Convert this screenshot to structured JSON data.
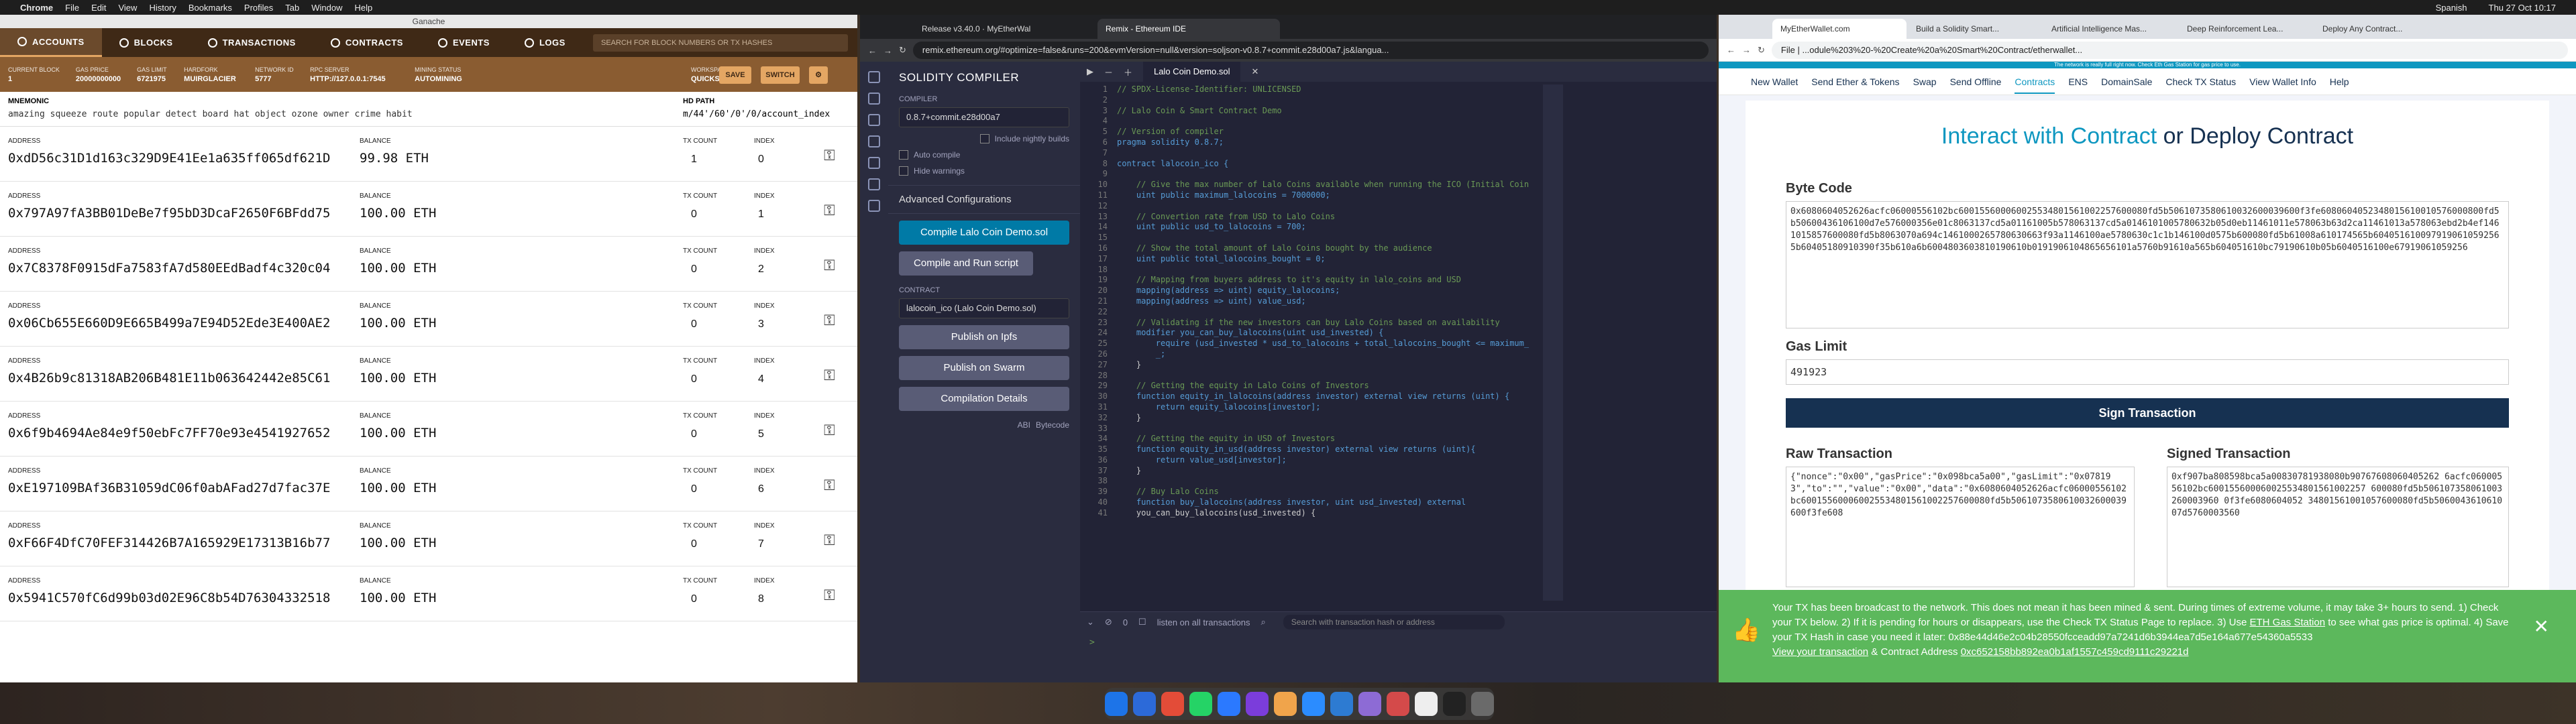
{
  "menubar": {
    "app": "Chrome",
    "items": [
      "File",
      "Edit",
      "View",
      "History",
      "Bookmarks",
      "Profiles",
      "Tab",
      "Window",
      "Help"
    ],
    "sys_input": "Spanish",
    "clock": "Thu 27 Oct 10:17"
  },
  "ganache": {
    "window_title": "Ganache",
    "nav": [
      "ACCOUNTS",
      "BLOCKS",
      "TRANSACTIONS",
      "CONTRACTS",
      "EVENTS",
      "LOGS"
    ],
    "search_placeholder": "SEARCH FOR BLOCK NUMBERS OR TX HASHES",
    "stats": [
      {
        "label": "CURRENT BLOCK",
        "value": "1"
      },
      {
        "label": "GAS PRICE",
        "value": "20000000000"
      },
      {
        "label": "GAS LIMIT",
        "value": "6721975"
      },
      {
        "label": "HARDFORK",
        "value": "MUIRGLACIER"
      },
      {
        "label": "NETWORK ID",
        "value": "5777"
      },
      {
        "label": "RPC SERVER",
        "value": "HTTP://127.0.0.1:7545"
      },
      {
        "label": "MINING STATUS",
        "value": "AUTOMINING"
      },
      {
        "label": "WORKSPACE",
        "value": "QUICKSTART"
      }
    ],
    "save": "SAVE",
    "switch": "SWITCH",
    "mnemonic_label": "MNEMONIC",
    "mnemonic": "amazing squeeze route popular detect board hat object ozone owner crime habit",
    "hdpath_label": "HD PATH",
    "hdpath": "m/44'/60'/0'/0/account_index",
    "col_address": "ADDRESS",
    "col_balance": "BALANCE",
    "col_tx": "TX COUNT",
    "col_index": "INDEX",
    "accounts": [
      {
        "address": "0xdD56c31D1d163c329D9E41Ee1a635ff065df621D",
        "balance": "99.98 ETH",
        "tx": "1",
        "index": "0"
      },
      {
        "address": "0x797A97fA3BB01DeBe7f95bD3DcaF2650F6BFdd75",
        "balance": "100.00 ETH",
        "tx": "0",
        "index": "1"
      },
      {
        "address": "0x7C8378F0915dFa7583fA7d580EEdBadf4c320c04",
        "balance": "100.00 ETH",
        "tx": "0",
        "index": "2"
      },
      {
        "address": "0x06Cb655E660D9E665B499a7E94D52Ede3E400AE2",
        "balance": "100.00 ETH",
        "tx": "0",
        "index": "3"
      },
      {
        "address": "0x4B26b9c81318AB206B481E11b063642442e85C61",
        "balance": "100.00 ETH",
        "tx": "0",
        "index": "4"
      },
      {
        "address": "0x6f9b4694Ae84e9f50ebFc7FF70e93e4541927652",
        "balance": "100.00 ETH",
        "tx": "0",
        "index": "5"
      },
      {
        "address": "0xE197109BAf36B31059dC06f0abAFad27d7fac37E",
        "balance": "100.00 ETH",
        "tx": "0",
        "index": "6"
      },
      {
        "address": "0xF66F4DfC70FEF314426B7A165929E17313B16b77",
        "balance": "100.00 ETH",
        "tx": "0",
        "index": "7"
      },
      {
        "address": "0x5941C570fC6d99b03d02E96C8b54D76304332518",
        "balance": "100.00 ETH",
        "tx": "0",
        "index": "8"
      }
    ]
  },
  "remix": {
    "tabs": [
      "Release v3.40.0 · MyEtherWal",
      "Remix - Ethereum IDE"
    ],
    "url": "remix.ethereum.org/#optimize=false&runs=200&evmVersion=null&version=soljson-v0.8.7+commit.e28d00a7.js&langua...",
    "panel_title": "SOLIDITY COMPILER",
    "compiler_label": "COMPILER",
    "compiler_value": "0.8.7+commit.e28d00a7",
    "nightly": "Include nightly builds",
    "auto": "Auto compile",
    "hide": "Hide warnings",
    "advanced": "Advanced Configurations",
    "compile_btn": "Compile Lalo Coin Demo.sol",
    "run_btn": "Compile and Run script",
    "contract_label": "CONTRACT",
    "contract_value": "lalocoin_ico (Lalo Coin Demo.sol)",
    "ipfs": "Publish on Ipfs",
    "swarm": "Publish on Swarm",
    "details": "Compilation Details",
    "abi": "ABI",
    "bytecode": "Bytecode",
    "file_tab": "Lalo Coin Demo.sol",
    "listen": "listen on all transactions",
    "search_ph": "Search with transaction hash or address",
    "tx_count": "0",
    "code": [
      "// SPDX-License-Identifier: UNLICENSED",
      "",
      "// Lalo Coin & Smart Contract Demo",
      "",
      "// Version of compiler",
      "pragma solidity 0.8.7;",
      "",
      "contract lalocoin_ico {",
      "",
      "    // Give the max number of Lalo Coins available when running the ICO (Initial Coin",
      "    uint public maximum_lalocoins = 7000000;",
      "",
      "    // Convertion rate from USD to Lalo Coins",
      "    uint public usd_to_lalocoins = 700;",
      "",
      "    // Show the total amount of Lalo Coins bought by the audience",
      "    uint public total_lalocoins_bought = 0;",
      "",
      "    // Mapping from buyers address to it's equity in lalo_coins and USD",
      "    mapping(address => uint) equity_lalocoins;",
      "    mapping(address => uint) value_usd;",
      "",
      "    // Validating if the new investors can buy Lalo Coins based on availability",
      "    modifier you_can_buy_lalocoins(uint usd_invested) {",
      "        require (usd_invested * usd_to_lalocoins + total_lalocoins_bought <= maximum_",
      "        _;",
      "    }",
      "",
      "    // Getting the equity in Lalo Coins of Investors",
      "    function equity_in_lalocoins(address investor) external view returns (uint) {",
      "        return equity_lalocoins[investor];",
      "    }",
      "",
      "    // Getting the equity in USD of Investors",
      "    function equity_in_usd(address investor) external view returns (uint){",
      "        return value_usd[investor];",
      "    }",
      "",
      "    // Buy Lalo Coins",
      "    function buy_lalocoins(address investor, uint usd_invested) external",
      "    you_can_buy_lalocoins(usd_invested) {"
    ]
  },
  "mew": {
    "tabs": [
      "MyEtherWallet.com",
      "Build a Solidity Smart...",
      "Artificial Intelligence Mas...",
      "Deep Reinforcement Lea...",
      "Deploy Any Contract..."
    ],
    "url": "File | ...odule%203%20-%20Create%20a%20Smart%20Contract/etherwallet...",
    "warn": "The network is really full right now. Check Eth Gas Station for gas price to use.",
    "nav": [
      "New Wallet",
      "Send Ether & Tokens",
      "Swap",
      "Send Offline",
      "Contracts",
      "ENS",
      "DomainSale",
      "Check TX Status",
      "View Wallet Info",
      "Help"
    ],
    "heading_a": "Interact with Contract",
    "heading_or": " or ",
    "heading_b": "Deploy Contract",
    "bytecode_label": "Byte Code",
    "bytecode": "0x6080604052626acfc06000556102bc600155600060025534801561002257600080fd5b5061073580610032600039600f3fe6080604052348015610010576000800fd5b50600436106100d7e576000356e01c8063137cd5a01161005b578063137cd5a0146101005780632b05d0eb11461011e578063b63d2ca11461013a578063ebd2b4ef1461015857600080fd5b8063070a694c1461000265780630663f93a1146100ae5780630c1c1b146100d0575b600080fd5b61008a610174565b6040516100979190610592565b60405180910390f35b610a6b6004803603810190610b0191906104865656101a5760b91610a565b604051610bc79190610b05b6040516100e67919061059256",
    "gaslimit_label": "Gas Limit",
    "gaslimit": "491923",
    "sign": "Sign Transaction",
    "raw_label": "Raw Transaction",
    "raw": "{\"nonce\":\"0x00\",\"gasPrice\":\"0x098bca5a00\",\"gasLimit\":\"0x078193\",\"to\":\"\",\"value\":\"0x00\",\"data\":\"0x6080604052626acfc06000556102bc600155600060025534801561002257600080fd5b5061073580610032600039600f3fe608",
    "signed_label": "Signed Transaction",
    "signed": "0xf907ba808598bca5a00830781938080b90767608060405262 6acfc06000556102bc600155600060025534801561002257 600080fd5b506107358061003260003960 0f3fe6080604052 34801561001057600080fd5b5060043610610 07d5760003560",
    "toast_text": "Your TX has been broadcast to the network. This does not mean it has been mined & sent. During times of extreme volume, it may take 3+ hours to send. 1) Check your TX below. 2) If it is pending for hours or disappears, use the Check TX Status Page to replace. 3) Use ",
    "toast_link1": "ETH Gas Station",
    "toast_text2": " to see what gas price is optimal. 4) Save your TX Hash in case you need it later: 0x88e44d46e2c04b28550fcceadd97a7241d6b3944ea7d5e164a677e54360a5533",
    "toast_view": "View your transaction",
    "toast_addr_label": " & Contract Address ",
    "toast_addr": "0xc652158bb892ea0b1af1557c459cd9111c29221d"
  }
}
